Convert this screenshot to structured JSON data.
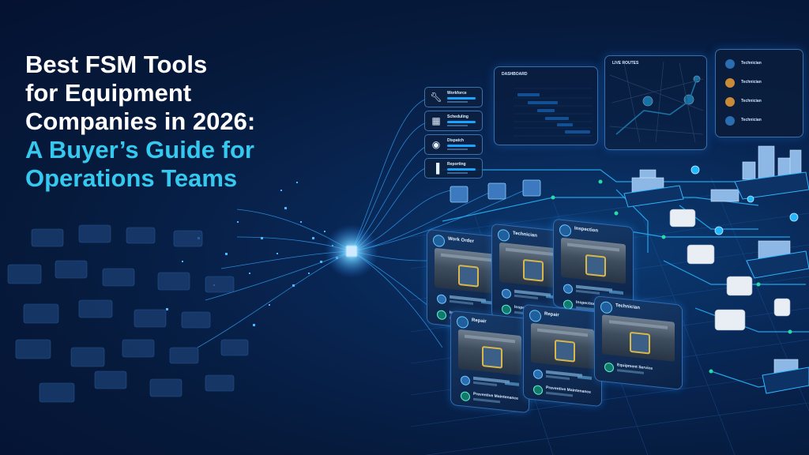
{
  "headline": {
    "line_white": "Best FSM Tools\nfor Equipment\nCompanies in 2026:",
    "line_cyan": "A Buyer’s Guide for\nOperations Teams"
  },
  "colors": {
    "headline_white": "#ffffff",
    "headline_cyan": "#35c9f0",
    "glow": "#1aa3ff",
    "accent_green": "#2bd9a8"
  },
  "side_widgets": [
    {
      "label": "Workforce",
      "icon": "wrench-icon"
    },
    {
      "label": "Scheduling",
      "icon": "calendar-icon"
    },
    {
      "label": "Dispatch",
      "icon": "location-pin-icon"
    },
    {
      "label": "Reporting",
      "icon": "chart-icon"
    }
  ],
  "schedule_panel": {
    "title": "DASHBOARD"
  },
  "map_panel": {
    "title": "LIVE ROUTES"
  },
  "technician_panel": {
    "items": [
      "Technician",
      "Technician",
      "Technician",
      "Technician"
    ]
  },
  "job_cards": [
    {
      "title": "Work Order",
      "subtitle": "Inspection Maintenance"
    },
    {
      "title": "Technician",
      "subtitle": "Inspection Maintenance"
    },
    {
      "title": "Inspection",
      "subtitle": "Inspection Maintenance"
    },
    {
      "title": "Repair",
      "subtitle": "Preventive Maintenance"
    },
    {
      "title": "Repair",
      "subtitle": "Preventive Maintenance"
    },
    {
      "title": "Technician",
      "subtitle": "Equipment Service"
    }
  ]
}
